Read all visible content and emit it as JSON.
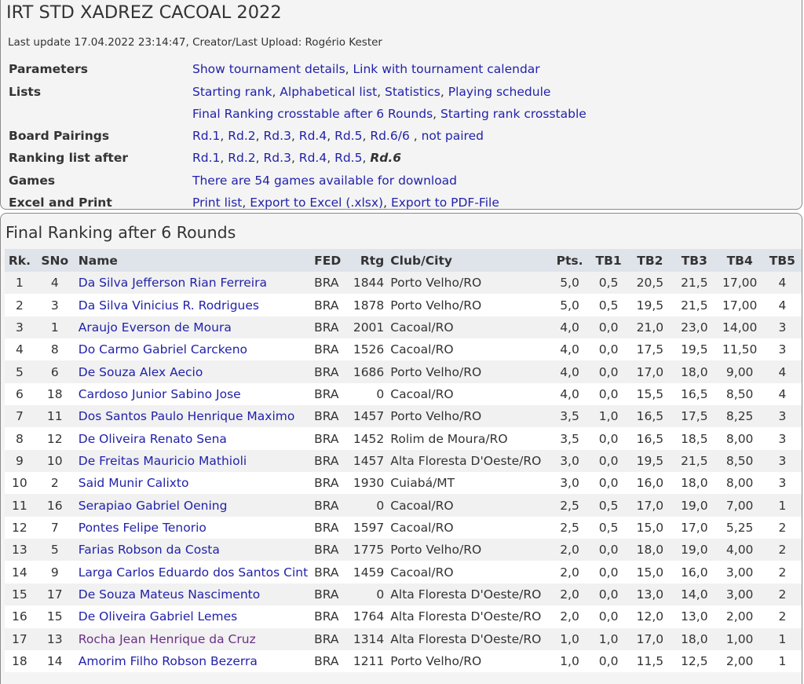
{
  "header": {
    "title": "IRT STD XADREZ CACOAL 2022",
    "last_update": "Last update 17.04.2022 23:14:47, Creator/Last Upload: Rogério Kester"
  },
  "params": [
    {
      "label": "Parameters",
      "items": [
        {
          "text": "Show tournament details",
          "link": true
        },
        {
          "text": ", ",
          "link": false
        },
        {
          "text": "Link with tournament calendar",
          "link": true
        }
      ]
    },
    {
      "label": "Lists",
      "items": [
        {
          "text": "Starting rank",
          "link": true
        },
        {
          "text": ", ",
          "link": false
        },
        {
          "text": "Alphabetical list",
          "link": true
        },
        {
          "text": ", ",
          "link": false
        },
        {
          "text": "Statistics",
          "link": true
        },
        {
          "text": ", ",
          "link": false
        },
        {
          "text": "Playing schedule",
          "link": true
        }
      ]
    },
    {
      "label": "",
      "items": [
        {
          "text": "Final Ranking crosstable after 6 Rounds",
          "link": true
        },
        {
          "text": ", ",
          "link": false
        },
        {
          "text": "Starting rank crosstable",
          "link": true
        }
      ]
    },
    {
      "label": "Board Pairings",
      "items": [
        {
          "text": "Rd.1",
          "link": true
        },
        {
          "text": ", ",
          "link": false
        },
        {
          "text": "Rd.2",
          "link": true
        },
        {
          "text": ", ",
          "link": false
        },
        {
          "text": "Rd.3",
          "link": true
        },
        {
          "text": ", ",
          "link": false
        },
        {
          "text": "Rd.4",
          "link": true
        },
        {
          "text": ", ",
          "link": false
        },
        {
          "text": "Rd.5",
          "link": true
        },
        {
          "text": ", ",
          "link": false
        },
        {
          "text": "Rd.6/6",
          "link": true
        },
        {
          "text": " , ",
          "link": false
        },
        {
          "text": "not paired",
          "link": true
        }
      ]
    },
    {
      "label": "Ranking list after",
      "items": [
        {
          "text": "Rd.1",
          "link": true
        },
        {
          "text": ", ",
          "link": false
        },
        {
          "text": "Rd.2",
          "link": true
        },
        {
          "text": ", ",
          "link": false
        },
        {
          "text": "Rd.3",
          "link": true
        },
        {
          "text": ", ",
          "link": false
        },
        {
          "text": "Rd.4",
          "link": true
        },
        {
          "text": ", ",
          "link": false
        },
        {
          "text": "Rd.5",
          "link": true
        },
        {
          "text": ", ",
          "link": false
        },
        {
          "text": "Rd.6",
          "link": false,
          "current": true
        }
      ]
    },
    {
      "label": "Games",
      "items": [
        {
          "text": "There are 54 games available for download",
          "link": true
        }
      ]
    },
    {
      "label": "Excel and Print",
      "items": [
        {
          "text": "Print list",
          "link": true
        },
        {
          "text": ", ",
          "link": false
        },
        {
          "text": "Export to Excel (.xlsx)",
          "link": true
        },
        {
          "text": ", ",
          "link": false
        },
        {
          "text": "Export to PDF-File",
          "link": true
        }
      ]
    }
  ],
  "ranking": {
    "title": "Final Ranking after 6 Rounds",
    "columns": [
      "Rk.",
      "SNo",
      "Name",
      "FED",
      "Rtg",
      "Club/City",
      "Pts.",
      "TB1",
      "TB2",
      "TB3",
      "TB4",
      "TB5"
    ],
    "rows": [
      {
        "rk": "1",
        "sno": "4",
        "name": "Da Silva Jefferson Rian Ferreira",
        "fed": "BRA",
        "rtg": "1844",
        "club": "Porto Velho/RO",
        "pts": "5,0",
        "tb1": "0,5",
        "tb2": "20,5",
        "tb3": "21,5",
        "tb4": "17,00",
        "tb5": "4"
      },
      {
        "rk": "2",
        "sno": "3",
        "name": "Da Silva Vinicius R. Rodrigues",
        "fed": "BRA",
        "rtg": "1878",
        "club": "Porto Velho/RO",
        "pts": "5,0",
        "tb1": "0,5",
        "tb2": "19,5",
        "tb3": "21,5",
        "tb4": "17,00",
        "tb5": "4"
      },
      {
        "rk": "3",
        "sno": "1",
        "name": "Araujo Everson de Moura",
        "fed": "BRA",
        "rtg": "2001",
        "club": "Cacoal/RO",
        "pts": "4,0",
        "tb1": "0,0",
        "tb2": "21,0",
        "tb3": "23,0",
        "tb4": "14,00",
        "tb5": "3"
      },
      {
        "rk": "4",
        "sno": "8",
        "name": "Do Carmo Gabriel Carckeno",
        "fed": "BRA",
        "rtg": "1526",
        "club": "Cacoal/RO",
        "pts": "4,0",
        "tb1": "0,0",
        "tb2": "17,5",
        "tb3": "19,5",
        "tb4": "11,50",
        "tb5": "3"
      },
      {
        "rk": "5",
        "sno": "6",
        "name": "De Souza Alex Aecio",
        "fed": "BRA",
        "rtg": "1686",
        "club": "Porto Velho/RO",
        "pts": "4,0",
        "tb1": "0,0",
        "tb2": "17,0",
        "tb3": "18,0",
        "tb4": "9,00",
        "tb5": "4"
      },
      {
        "rk": "6",
        "sno": "18",
        "name": "Cardoso Junior Sabino Jose",
        "fed": "BRA",
        "rtg": "0",
        "club": "Cacoal/RO",
        "pts": "4,0",
        "tb1": "0,0",
        "tb2": "15,5",
        "tb3": "16,5",
        "tb4": "8,50",
        "tb5": "4"
      },
      {
        "rk": "7",
        "sno": "11",
        "name": "Dos Santos Paulo Henrique Maximo",
        "fed": "BRA",
        "rtg": "1457",
        "club": "Porto Velho/RO",
        "pts": "3,5",
        "tb1": "1,0",
        "tb2": "16,5",
        "tb3": "17,5",
        "tb4": "8,25",
        "tb5": "3"
      },
      {
        "rk": "8",
        "sno": "12",
        "name": "De Oliveira Renato Sena",
        "fed": "BRA",
        "rtg": "1452",
        "club": "Rolim de Moura/RO",
        "pts": "3,5",
        "tb1": "0,0",
        "tb2": "16,5",
        "tb3": "18,5",
        "tb4": "8,00",
        "tb5": "3"
      },
      {
        "rk": "9",
        "sno": "10",
        "name": "De Freitas Mauricio Mathioli",
        "fed": "BRA",
        "rtg": "1457",
        "club": "Alta Floresta D'Oeste/RO",
        "pts": "3,0",
        "tb1": "0,0",
        "tb2": "19,5",
        "tb3": "21,5",
        "tb4": "8,50",
        "tb5": "3"
      },
      {
        "rk": "10",
        "sno": "2",
        "name": "Said Munir Calixto",
        "fed": "BRA",
        "rtg": "1930",
        "club": "Cuiabá/MT",
        "pts": "3,0",
        "tb1": "0,0",
        "tb2": "16,0",
        "tb3": "18,0",
        "tb4": "8,00",
        "tb5": "3"
      },
      {
        "rk": "11",
        "sno": "16",
        "name": "Serapiao Gabriel Oening",
        "fed": "BRA",
        "rtg": "0",
        "club": "Cacoal/RO",
        "pts": "2,5",
        "tb1": "0,5",
        "tb2": "17,0",
        "tb3": "19,0",
        "tb4": "7,00",
        "tb5": "1"
      },
      {
        "rk": "12",
        "sno": "7",
        "name": "Pontes Felipe Tenorio",
        "fed": "BRA",
        "rtg": "1597",
        "club": "Cacoal/RO",
        "pts": "2,5",
        "tb1": "0,5",
        "tb2": "15,0",
        "tb3": "17,0",
        "tb4": "5,25",
        "tb5": "2"
      },
      {
        "rk": "13",
        "sno": "5",
        "name": "Farias Robson da Costa",
        "fed": "BRA",
        "rtg": "1775",
        "club": "Porto Velho/RO",
        "pts": "2,0",
        "tb1": "0,0",
        "tb2": "18,0",
        "tb3": "19,0",
        "tb4": "4,00",
        "tb5": "2"
      },
      {
        "rk": "14",
        "sno": "9",
        "name": "Larga Carlos Eduardo dos Santos Cint",
        "fed": "BRA",
        "rtg": "1459",
        "club": "Cacoal/RO",
        "pts": "2,0",
        "tb1": "0,0",
        "tb2": "15,0",
        "tb3": "16,0",
        "tb4": "3,00",
        "tb5": "2"
      },
      {
        "rk": "15",
        "sno": "17",
        "name": "De Souza Mateus Nascimento",
        "fed": "BRA",
        "rtg": "0",
        "club": "Alta Floresta D'Oeste/RO",
        "pts": "2,0",
        "tb1": "0,0",
        "tb2": "13,0",
        "tb3": "14,0",
        "tb4": "3,00",
        "tb5": "2"
      },
      {
        "rk": "16",
        "sno": "15",
        "name": "De Oliveira Gabriel Lemes",
        "fed": "BRA",
        "rtg": "1764",
        "club": "Alta Floresta D'Oeste/RO",
        "pts": "2,0",
        "tb1": "0,0",
        "tb2": "12,0",
        "tb3": "13,0",
        "tb4": "2,00",
        "tb5": "2"
      },
      {
        "rk": "17",
        "sno": "13",
        "name": "Rocha Jean Henrique da Cruz",
        "fed": "BRA",
        "rtg": "1314",
        "club": "Alta Floresta D'Oeste/RO",
        "pts": "1,0",
        "tb1": "1,0",
        "tb2": "17,0",
        "tb3": "18,0",
        "tb4": "1,00",
        "tb5": "1",
        "visited": true
      },
      {
        "rk": "18",
        "sno": "14",
        "name": "Amorim Filho Robson Bezerra",
        "fed": "BRA",
        "rtg": "1211",
        "club": "Porto Velho/RO",
        "pts": "1,0",
        "tb1": "0,0",
        "tb2": "11,5",
        "tb3": "12,5",
        "tb4": "2,00",
        "tb5": "1"
      }
    ]
  },
  "colors": {
    "link": "#2222aa",
    "visited_link": "#6b2f86",
    "header_bg": "#dfe3ea",
    "panel_bg": "#f4f4f4",
    "row_alt_bg": "#f1f1f1"
  }
}
